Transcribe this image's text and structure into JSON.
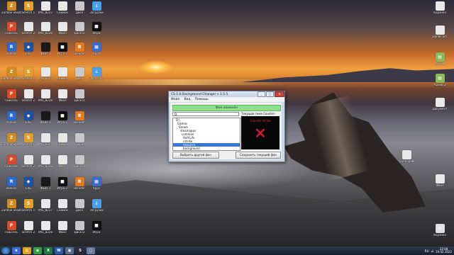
{
  "desktop_icons_left": [
    {
      "label": "Zombie Shooter",
      "color": "#d08a20",
      "glyph": "Z",
      "icon": "game-icon"
    },
    {
      "label": "Stretch 1",
      "color": "#e0a030",
      "glyph": "S",
      "icon": "app-icon"
    },
    {
      "label": "IMG_8227",
      "color": "#e8e8e8",
      "glyph": "",
      "icon": "image-file-icon"
    },
    {
      "label": "Снимок",
      "color": "#e8e8e8",
      "glyph": "",
      "icon": "image-file-icon"
    },
    {
      "label": "Диск",
      "color": "#c8c8c8",
      "glyph": "",
      "icon": "drive-icon"
    },
    {
      "label": "Загрузки",
      "color": "#4aa0e8",
      "glyph": "↓",
      "icon": "download-icon"
    },
    {
      "label": "Пиксель",
      "color": "#d84a2a",
      "glyph": "P",
      "icon": "app-icon"
    },
    {
      "label": "Stretch 2",
      "color": "#e8e8e8",
      "glyph": "",
      "icon": "document-icon"
    },
    {
      "label": "IMG_8228",
      "color": "#e8e8e8",
      "glyph": "",
      "icon": "image-file-icon"
    },
    {
      "label": "Файл",
      "color": "#e8e8e8",
      "glyph": "",
      "icon": "document-icon"
    },
    {
      "label": "Диск D",
      "color": "#c8c8c8",
      "glyph": "",
      "icon": "drive-icon"
    },
    {
      "label": "Игра",
      "color": "#101010",
      "glyph": "■",
      "icon": "game-icon"
    },
    {
      "label": "Radeon",
      "color": "#2a6ac8",
      "glyph": "R",
      "icon": "app-icon"
    },
    {
      "label": "EXE",
      "color": "#2050a0",
      "glyph": "◆",
      "icon": "app-icon"
    },
    {
      "label": "Файл 1",
      "color": "#1a1a1a",
      "glyph": "",
      "icon": "video-file-icon"
    },
    {
      "label": "Игра 2",
      "color": "#101010",
      "glyph": "■",
      "icon": "game-icon"
    },
    {
      "label": "Blender",
      "color": "#e07a20",
      "glyph": "B",
      "icon": "app-icon"
    },
    {
      "label": "Apps",
      "color": "#3a6ad0",
      "glyph": "▦",
      "icon": "app-icon"
    }
  ],
  "desktop_icons_right": [
    {
      "label": "Корзина",
      "color": "#e8e8e8",
      "glyph": "",
      "icon": "recycle-bin-icon"
    },
    {
      "label": "Bandicam",
      "color": "#e8e8e8",
      "glyph": "",
      "icon": "document-icon"
    },
    {
      "label": "Архив",
      "color": "#8ab85a",
      "glyph": "▤",
      "icon": "archive-icon"
    },
    {
      "label": "Архив 2",
      "color": "#8ab85a",
      "glyph": "▤",
      "icon": "archive-icon"
    },
    {
      "label": "Документ",
      "color": "#e8e8e8",
      "glyph": "",
      "icon": "document-icon"
    },
    {
      "label": "Сценарий",
      "color": "#e8e8e8",
      "glyph": "",
      "icon": "document-icon"
    },
    {
      "label": "Файл",
      "color": "#e8e8e8",
      "glyph": "",
      "icon": "document-icon"
    },
    {
      "label": "Корзина",
      "color": "#e0e0e0",
      "glyph": "♻",
      "icon": "recycle-bin-icon"
    }
  ],
  "window": {
    "title": "CS 1.6 Background Changer v 3.5.5",
    "menu": [
      "Файл",
      "Вид",
      "Помощь"
    ],
    "status_bar": "Фон изменён",
    "drive": "D:",
    "tree": [
      "D:\\",
      "Games",
      "Steam",
      "steamapps",
      "common",
      "Half-Life",
      "cstrike",
      "resource",
      "background",
      "ru"
    ],
    "preview_label": "Текущая тема Counter-Strike",
    "preview_text": "Counter-Strike",
    "btn_pick": "Выбрать другой фон",
    "btn_save": "Сохранить текущий фон"
  },
  "taskbar": {
    "apps": [
      {
        "color": "#3a6ad0",
        "glyph": "e",
        "icon": "ie-icon"
      },
      {
        "color": "#e0a020",
        "glyph": "▤",
        "icon": "explorer-icon"
      },
      {
        "color": "#30a040",
        "glyph": "◉",
        "icon": "chrome-icon"
      },
      {
        "color": "#1e7a3e",
        "glyph": "X",
        "icon": "excel-icon"
      },
      {
        "color": "#2a5ab0",
        "glyph": "W",
        "icon": "word-icon"
      },
      {
        "color": "#5a6a8a",
        "glyph": "▣",
        "icon": "app-icon"
      },
      {
        "color": "#2a2a3a",
        "glyph": "S",
        "icon": "steam-icon"
      },
      {
        "color": "#6a7a9a",
        "glyph": "▢",
        "icon": "window-icon"
      }
    ],
    "lang": "RU",
    "time": "22:08",
    "date": "19.02.2022"
  }
}
